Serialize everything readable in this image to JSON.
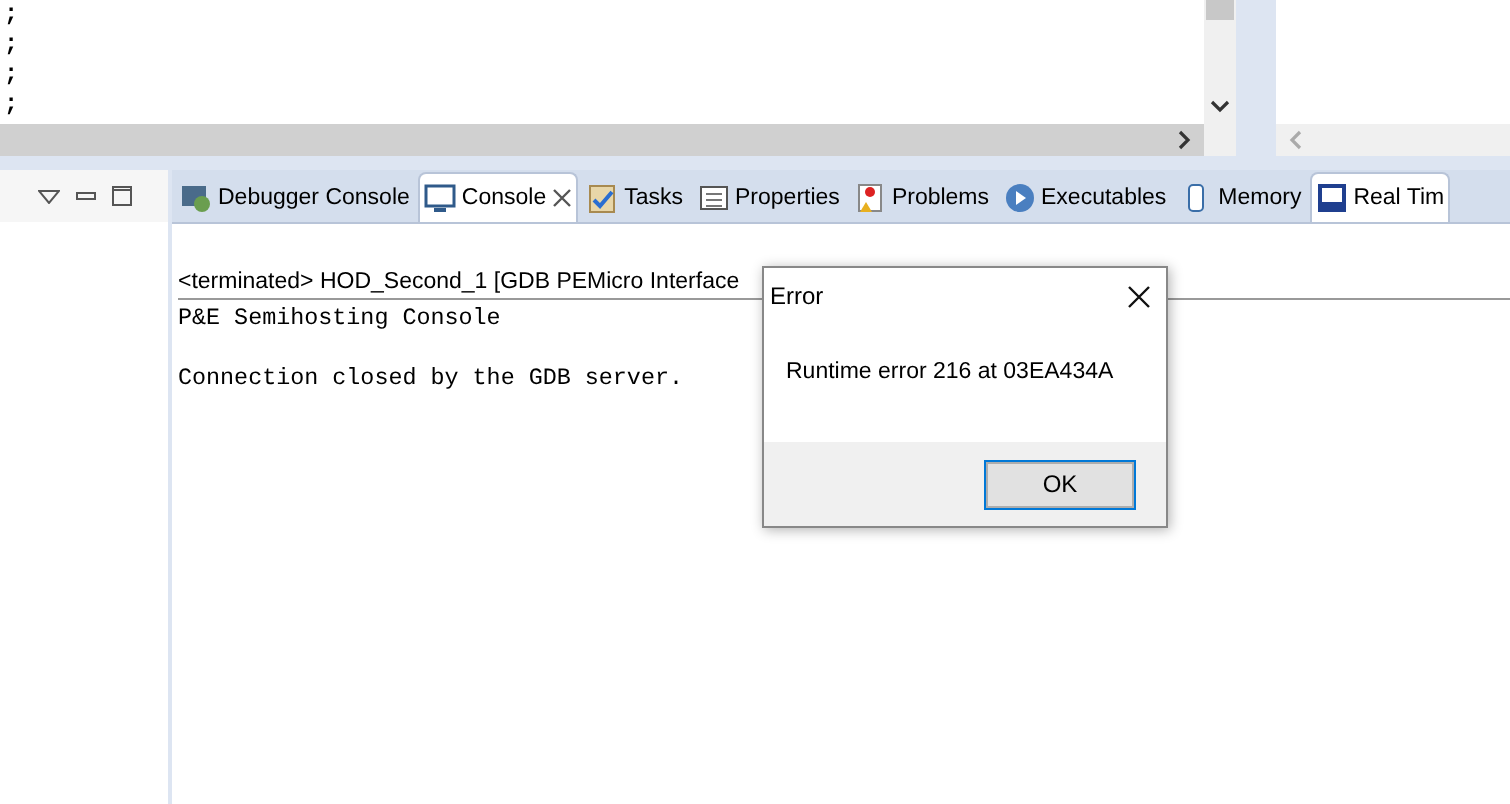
{
  "editor": {
    "lines": [
      ";",
      ";",
      ";",
      ";"
    ]
  },
  "console_view": {
    "tabs": [
      {
        "label": "Debugger Console",
        "selected": false,
        "closable": false
      },
      {
        "label": "Console",
        "selected": true,
        "closable": true
      },
      {
        "label": "Tasks",
        "selected": false,
        "closable": false
      },
      {
        "label": "Properties",
        "selected": false,
        "closable": false
      },
      {
        "label": "Problems",
        "selected": false,
        "closable": false
      },
      {
        "label": "Executables",
        "selected": false,
        "closable": false
      },
      {
        "label": "Memory",
        "selected": false,
        "closable": false
      },
      {
        "label": "Real Tim",
        "selected": true,
        "closable": false
      }
    ],
    "header": "<terminated> HOD_Second_1 [GDB PEMicro Interface",
    "lines": [
      "P&E Semihosting Console",
      "Connection closed by the GDB server."
    ]
  },
  "dialog": {
    "title": "Error",
    "message": "Runtime error 216 at 03EA434A",
    "buttons": [
      "OK"
    ]
  }
}
